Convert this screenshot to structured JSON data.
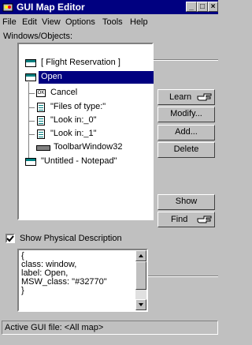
{
  "window": {
    "title": "GUI Map Editor",
    "app_icon": "gui-map-editor-icon",
    "controls": [
      "minimize",
      "maximize",
      "close"
    ]
  },
  "menu": [
    "File",
    "Edit",
    "View",
    "Options",
    "Tools",
    "Help"
  ],
  "tree": {
    "label": "Windows/Objects:",
    "items": [
      {
        "text": "[ Flight Reservation ]",
        "icon": "window-icon",
        "level": 0,
        "selected": false
      },
      {
        "text": "Open",
        "icon": "window-icon",
        "level": 0,
        "selected": true
      },
      {
        "text": "Cancel",
        "icon": "push-button-icon",
        "level": 1,
        "selected": false
      },
      {
        "text": "\"Files of type:\"",
        "icon": "list-icon",
        "level": 1,
        "selected": false
      },
      {
        "text": "\"Look in:_0\"",
        "icon": "list-icon",
        "level": 1,
        "selected": false
      },
      {
        "text": "\"Look in:_1\"",
        "icon": "list-icon",
        "level": 1,
        "selected": false
      },
      {
        "text": "ToolbarWindow32",
        "icon": "toolbar-icon",
        "level": 1,
        "selected": false
      },
      {
        "text": "\"Untitled - Notepad\"",
        "icon": "window-icon",
        "level": 0,
        "selected": false
      }
    ]
  },
  "buttons": {
    "learn": "Learn",
    "modify": "Modify...",
    "add": "Add...",
    "delete": "Delete",
    "show": "Show",
    "find": "Find"
  },
  "physical_description": {
    "checkbox_label": "Show Physical Description",
    "checked": true,
    "lines": [
      "{",
      "class: window,",
      "label: Open,",
      "MSW_class: \"#32770\"",
      "}"
    ]
  },
  "status": {
    "text": "Active GUI file: <All map>"
  }
}
